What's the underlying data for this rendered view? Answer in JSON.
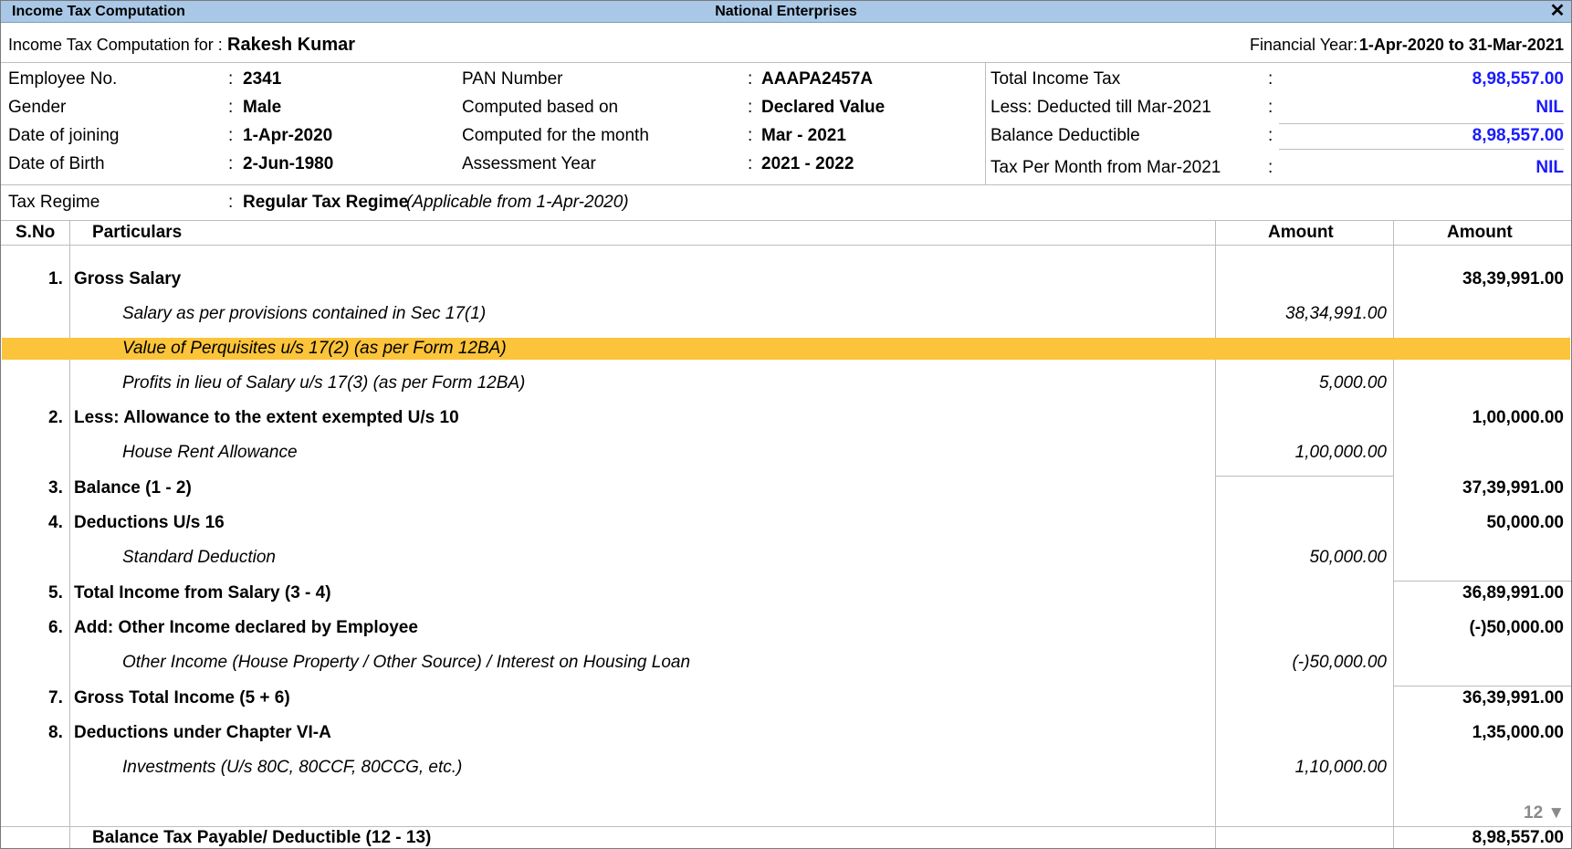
{
  "window": {
    "title": "Income Tax Computation",
    "company": "National Enterprises",
    "close_icon": "close-icon"
  },
  "header": {
    "for_label": "Income Tax Computation for :",
    "employee_name": "Rakesh Kumar",
    "fy_label": "Financial Year:",
    "fy_value": "1-Apr-2020 to 31-Mar-2021"
  },
  "employee_info": {
    "left": [
      {
        "label": "Employee No.",
        "value": "2341"
      },
      {
        "label": "Gender",
        "value": "Male"
      },
      {
        "label": "Date of joining",
        "value": "1-Apr-2020"
      },
      {
        "label": "Date of Birth",
        "value": "2-Jun-1980"
      }
    ],
    "middle": [
      {
        "label": "PAN Number",
        "value": "AAAPA2457A"
      },
      {
        "label": "Computed based on",
        "value": "Declared Value"
      },
      {
        "label": "Computed for the month",
        "value": "Mar - 2021"
      },
      {
        "label": "Assessment Year",
        "value": "2021 - 2022"
      }
    ],
    "right": [
      {
        "label": "Total Income Tax",
        "value": "8,98,557.00"
      },
      {
        "label": "Less: Deducted till Mar-2021",
        "value": "NIL"
      },
      {
        "label": "Balance Deductible",
        "value": "8,98,557.00"
      },
      {
        "label": "Tax Per Month from Mar-2021",
        "value": "NIL"
      }
    ],
    "colon": ":",
    "tax_regime": {
      "label": "Tax Regime",
      "value": "Regular Tax Regime",
      "note": "(Applicable from 1-Apr-2020)"
    }
  },
  "table": {
    "headers": {
      "sno": "S.No",
      "particulars": "Particulars",
      "amount1": "Amount",
      "amount2": "Amount"
    },
    "rows": [
      {
        "sno": "1.",
        "particulars": "Gross Salary",
        "amount1": "",
        "amount2": "38,39,991.00"
      },
      {
        "sno": "",
        "particulars": "Salary as per provisions contained in Sec 17(1)",
        "amount1": "38,34,991.00",
        "amount2": ""
      },
      {
        "sno": "",
        "particulars": "Value of Perquisites u/s 17(2) (as per Form 12BA)",
        "amount1": "",
        "amount2": ""
      },
      {
        "sno": "",
        "particulars": "Profits in lieu of Salary u/s 17(3) (as per Form 12BA)",
        "amount1": "5,000.00",
        "amount2": ""
      },
      {
        "sno": "2.",
        "particulars": "Less: Allowance to the extent exempted U/s 10",
        "amount1": "",
        "amount2": "1,00,000.00"
      },
      {
        "sno": "",
        "particulars": "House Rent Allowance",
        "amount1": "1,00,000.00",
        "amount2": ""
      },
      {
        "sno": "3.",
        "particulars": "Balance (1 - 2)",
        "amount1": "",
        "amount2": "37,39,991.00"
      },
      {
        "sno": "4.",
        "particulars": "Deductions U/s 16",
        "amount1": "",
        "amount2": "50,000.00"
      },
      {
        "sno": "",
        "particulars": "Standard Deduction",
        "amount1": "50,000.00",
        "amount2": ""
      },
      {
        "sno": "5.",
        "particulars": "Total Income from Salary (3 - 4)",
        "amount1": "",
        "amount2": "36,89,991.00"
      },
      {
        "sno": "6.",
        "particulars": "Add: Other Income declared by Employee",
        "amount1": "",
        "amount2": "(-)50,000.00"
      },
      {
        "sno": "",
        "particulars": "Other Income (House Property / Other Source) / Interest on Housing Loan",
        "amount1": "(-)50,000.00",
        "amount2": ""
      },
      {
        "sno": "7.",
        "particulars": "Gross Total Income (5 + 6)",
        "amount1": "",
        "amount2": "36,39,991.00"
      },
      {
        "sno": "8.",
        "particulars": "Deductions under Chapter VI-A",
        "amount1": "",
        "amount2": "1,35,000.00"
      },
      {
        "sno": "",
        "particulars": "Investments (U/s 80C, 80CCF, 80CCG, etc.)",
        "amount1": "1,10,000.00",
        "amount2": ""
      }
    ],
    "scroll_indicator": "12 ▼",
    "footer": {
      "label": "Balance Tax Payable/ Deductible (12 - 13)",
      "amount": "8,98,557.00"
    }
  }
}
